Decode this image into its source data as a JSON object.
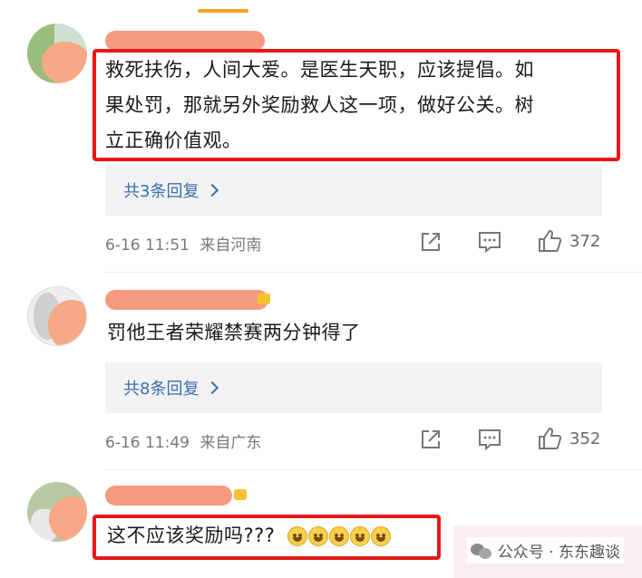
{
  "comments": [
    {
      "text": "救死扶伤，人间大爱。是医生天职，应该提倡。如果处罚，那就另外奖励救人这一项，做好公关。树立正确价值观。",
      "text_lines": [
        "救死扶伤，人间大爱。是医生天职，应该提倡。如",
        "果处罚，那就另外奖励救人这一项，做好公关。树",
        "立正确价值观。"
      ],
      "replies_label": "共3条回复",
      "date": "6-16 11:51",
      "location": "来自河南",
      "likes": "372"
    },
    {
      "text": "罚他王者荣耀禁赛两分钟得了",
      "replies_label": "共8条回复",
      "date": "6-16 11:49",
      "location": "来自广东",
      "likes": "352"
    },
    {
      "text": "这不应该奖励吗???"
    }
  ],
  "watermark": "公众号 · 东东趣谈",
  "icons": {
    "share": "share-icon",
    "comment": "comment-icon",
    "like": "thumbs-up-icon",
    "emoji": "grin-emoji-icon",
    "chevron": "chevron-right-icon",
    "wechat": "wechat-icon"
  },
  "colors": {
    "highlight_border": "#e81818",
    "reply_link": "#3a6fb0",
    "meta_text": "#777777",
    "redaction": "#f48f70"
  }
}
